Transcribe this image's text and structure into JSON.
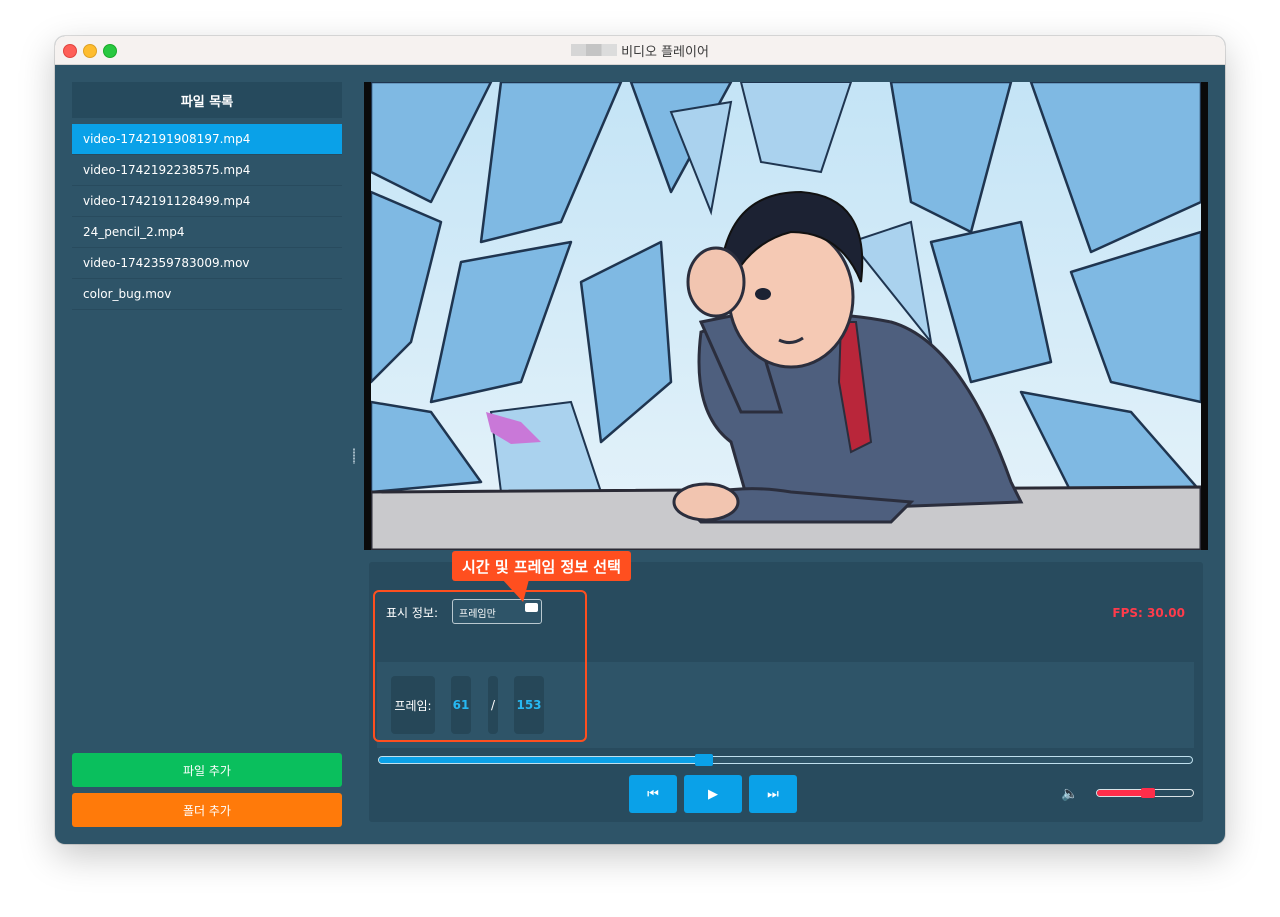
{
  "window": {
    "title": "비디오 플레이어"
  },
  "sidebar": {
    "header": "파일 목록",
    "files": [
      "video-1742191908197.mp4",
      "video-1742192238575.mp4",
      "video-1742191128499.mp4",
      "24_pencil_2.mp4",
      "video-1742359783009.mov",
      "color_bug.mov"
    ],
    "selected_index": 0,
    "add_file_button": "파일 추가",
    "add_folder_button": "폴더 추가"
  },
  "controls": {
    "display_label": "표시 정보:",
    "display_select": "프레임만",
    "fps": "FPS: 30.00",
    "frame_label": "프레임:",
    "current_frame": "61",
    "separator": "/",
    "total_frames": "153",
    "progress_fraction": 0.4,
    "volume_fraction": 0.6,
    "prev_icon": "⏮",
    "play_icon": "▶",
    "next_icon": "⏭",
    "volume_icon": "🔈"
  },
  "annotation": {
    "label": "시간 및 프레임 정보 선택"
  },
  "colors": {
    "accent": "#0aa1e8",
    "panel": "#2e5468",
    "add_file": "#0abf5d",
    "add_folder": "#ff7a0a",
    "fps_text": "#ff3b4b",
    "annotation": "#ff4f1f"
  }
}
